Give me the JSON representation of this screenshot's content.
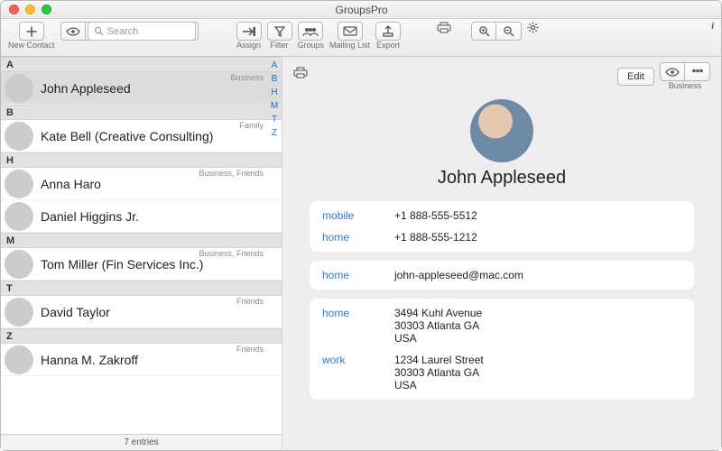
{
  "app_title": "GroupsPro",
  "toolbar": {
    "new_contact": "New Contact",
    "search_placeholder": "Search",
    "assign": "Assign",
    "filter": "Filter",
    "groups": "Groups",
    "mailing_list": "Mailing List",
    "export": "Export"
  },
  "index_letters": [
    "A",
    "B",
    "H",
    "M",
    "T",
    "Z"
  ],
  "sections": [
    {
      "letter": "A",
      "rows": [
        {
          "name": "John Appleseed",
          "tag": "Business",
          "selected": true
        }
      ]
    },
    {
      "letter": "B",
      "rows": [
        {
          "name": "Kate Bell (Creative Consulting)",
          "tag": "Family"
        }
      ]
    },
    {
      "letter": "H",
      "rows": [
        {
          "name": "Anna Haro",
          "tag": "Business, Friends"
        },
        {
          "name": "Daniel Higgins Jr.",
          "tag": ""
        }
      ]
    },
    {
      "letter": "M",
      "rows": [
        {
          "name": "Tom Miller (Fin Services Inc.)",
          "tag": "Business, Friends"
        }
      ]
    },
    {
      "letter": "T",
      "rows": [
        {
          "name": "David Taylor",
          "tag": "Friends"
        }
      ]
    },
    {
      "letter": "Z",
      "rows": [
        {
          "name": "Hanna M. Zakroff",
          "tag": "Friends"
        }
      ]
    }
  ],
  "footer": "7 entries",
  "detail": {
    "edit": "Edit",
    "business": "Business",
    "name": "John Appleseed",
    "phones": [
      {
        "label": "mobile",
        "value": "+1 888-555-5512"
      },
      {
        "label": "home",
        "value": "+1 888-555-1212"
      }
    ],
    "emails": [
      {
        "label": "home",
        "value": "john-appleseed@mac.com"
      }
    ],
    "addresses": [
      {
        "label": "home",
        "value": "3494 Kuhl Avenue\n30303 Atlanta GA\nUSA"
      },
      {
        "label": "work",
        "value": "1234 Laurel Street\n30303 Atlanta GA\nUSA"
      }
    ]
  }
}
